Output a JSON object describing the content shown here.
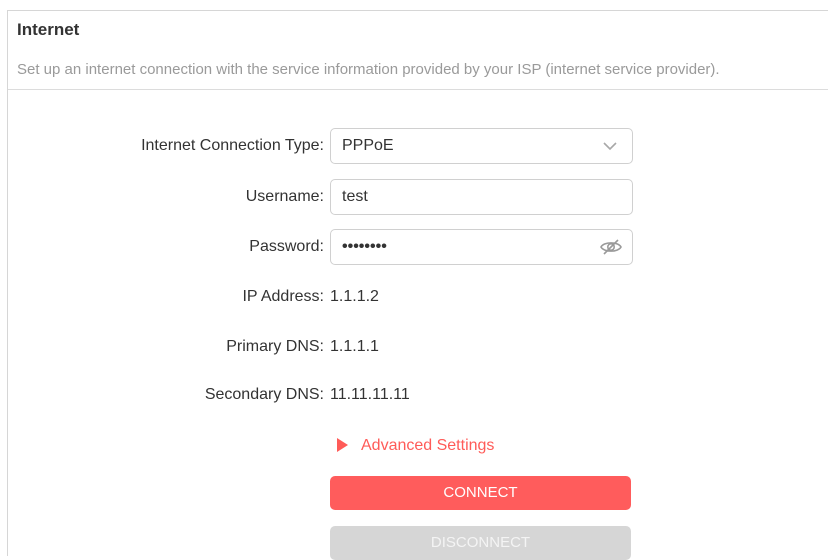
{
  "section": {
    "title": "Internet",
    "description": "Set up an internet connection with the service information provided by your ISP (internet service provider)."
  },
  "form": {
    "connection_type": {
      "label": "Internet Connection Type:",
      "value": "PPPoE",
      "icon": "chevron-down-icon"
    },
    "username": {
      "label": "Username:",
      "value": "test"
    },
    "password": {
      "label": "Password:",
      "value": "••••••••",
      "icon": "eye-off-icon"
    },
    "ip_address": {
      "label": "IP Address:",
      "value": "1.1.1.2"
    },
    "primary_dns": {
      "label": "Primary DNS:",
      "value": "1.1.1.1"
    },
    "secondary_dns": {
      "label": "Secondary DNS:",
      "value": "11.11.11.11"
    }
  },
  "advanced": {
    "label": "Advanced Settings",
    "icon": "triangle-right-icon"
  },
  "buttons": {
    "connect": "CONNECT",
    "disconnect": "DISCONNECT"
  },
  "colors": {
    "accent": "#ff5c5c",
    "disabled": "#d6d6d6",
    "label": "#333333",
    "description": "#9a9a9a",
    "border": "#d0d0d0"
  }
}
